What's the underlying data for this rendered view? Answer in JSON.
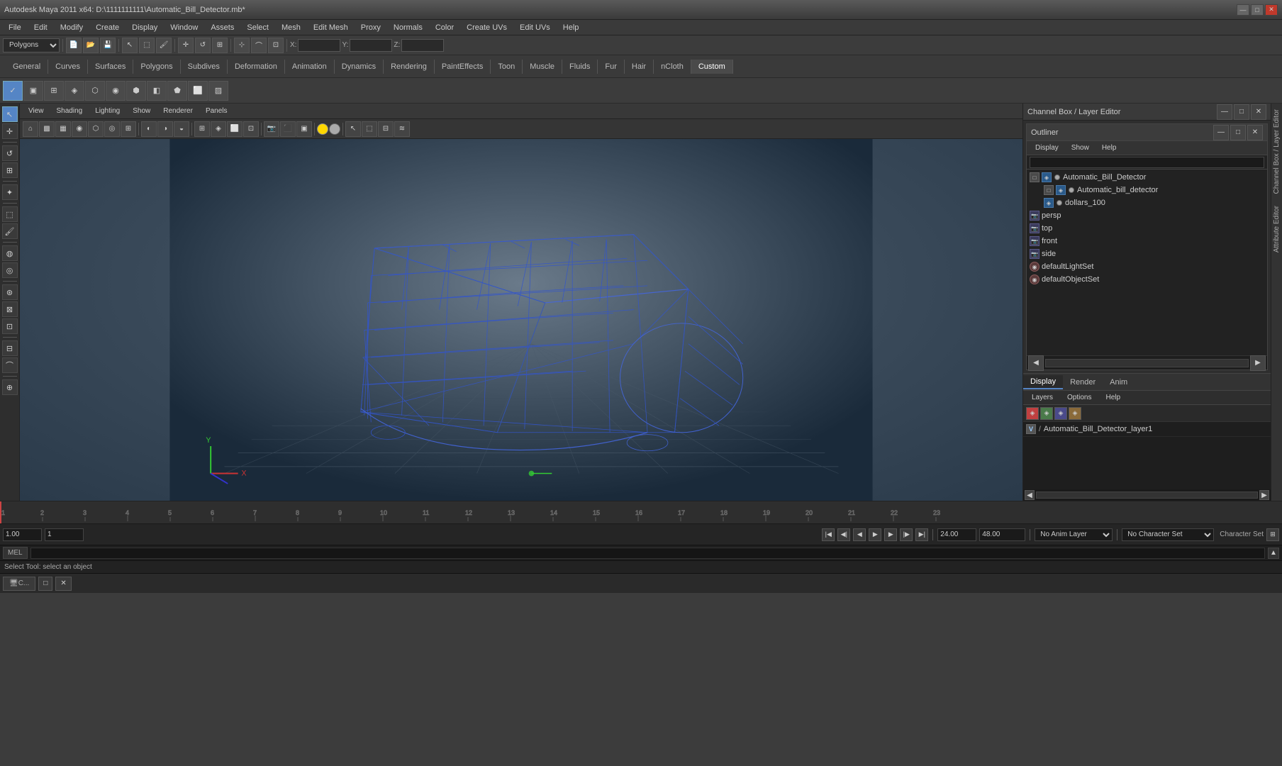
{
  "titleBar": {
    "title": "Autodesk Maya 2011 x64: D:\\1111111111\\Automatic_Bill_Detector.mb*",
    "controls": [
      "—",
      "□",
      "✕"
    ]
  },
  "menuBar": {
    "items": [
      "File",
      "Edit",
      "Modify",
      "Create",
      "Display",
      "Window",
      "Assets",
      "Select",
      "Mesh",
      "Edit Mesh",
      "Proxy",
      "Normals",
      "Color",
      "Create UVs",
      "Edit UVs",
      "Help"
    ]
  },
  "toolbar1": {
    "modeSelect": "Polygons",
    "coordLabels": [
      "X:",
      "Y:",
      "Z:"
    ]
  },
  "shelfBar": {
    "tabs": [
      "General",
      "Curves",
      "Surfaces",
      "Polygons",
      "Subdives",
      "Deformation",
      "Animation",
      "Dynamics",
      "Rendering",
      "PaintEffects",
      "Toon",
      "Muscle",
      "Fluids",
      "Fur",
      "Hair",
      "nCloth",
      "Custom"
    ]
  },
  "viewport": {
    "menuItems": [
      "View",
      "Shading",
      "Lighting",
      "Show",
      "Renderer",
      "Panels"
    ]
  },
  "outliner": {
    "title": "Outliner",
    "menuItems": [
      "Display",
      "Show",
      "Help"
    ],
    "items": [
      {
        "name": "Automatic_Bill_Detector",
        "indent": 0,
        "type": "transform",
        "expanded": true
      },
      {
        "name": "Automatic_bill_detector",
        "indent": 1,
        "type": "mesh",
        "expanded": true
      },
      {
        "name": "dollars_100",
        "indent": 1,
        "type": "mesh",
        "expanded": false
      },
      {
        "name": "persp",
        "indent": 0,
        "type": "camera"
      },
      {
        "name": "top",
        "indent": 0,
        "type": "camera"
      },
      {
        "name": "front",
        "indent": 0,
        "type": "camera"
      },
      {
        "name": "side",
        "indent": 0,
        "type": "camera"
      },
      {
        "name": "defaultLightSet",
        "indent": 0,
        "type": "set"
      },
      {
        "name": "defaultObjectSet",
        "indent": 0,
        "type": "set"
      }
    ]
  },
  "channelBox": {
    "title": "Channel Box / Layer Editor"
  },
  "layerEditor": {
    "tabs": [
      "Display",
      "Render",
      "Anim"
    ],
    "menuItems": [
      "Layers",
      "Options",
      "Help"
    ],
    "layer": {
      "v": "V",
      "path": "/",
      "name": "Automatic_Bill_Detector_layer1"
    }
  },
  "timeline": {
    "currentFrame": "1",
    "startFrame": "1.00",
    "endFrame": "24.00",
    "totalFrames": "48.00",
    "animLayer": "No Anim Layer",
    "characterSet": "No Character Set"
  },
  "bottomBar": {
    "commandLine": "MEL",
    "statusText": "Select Tool: select an object",
    "taskItems": [
      "C...",
      "□",
      "✕"
    ]
  },
  "rightSidebar": {
    "labels": [
      "Channel Box / Layer Editor",
      "Attribute Editor"
    ]
  }
}
